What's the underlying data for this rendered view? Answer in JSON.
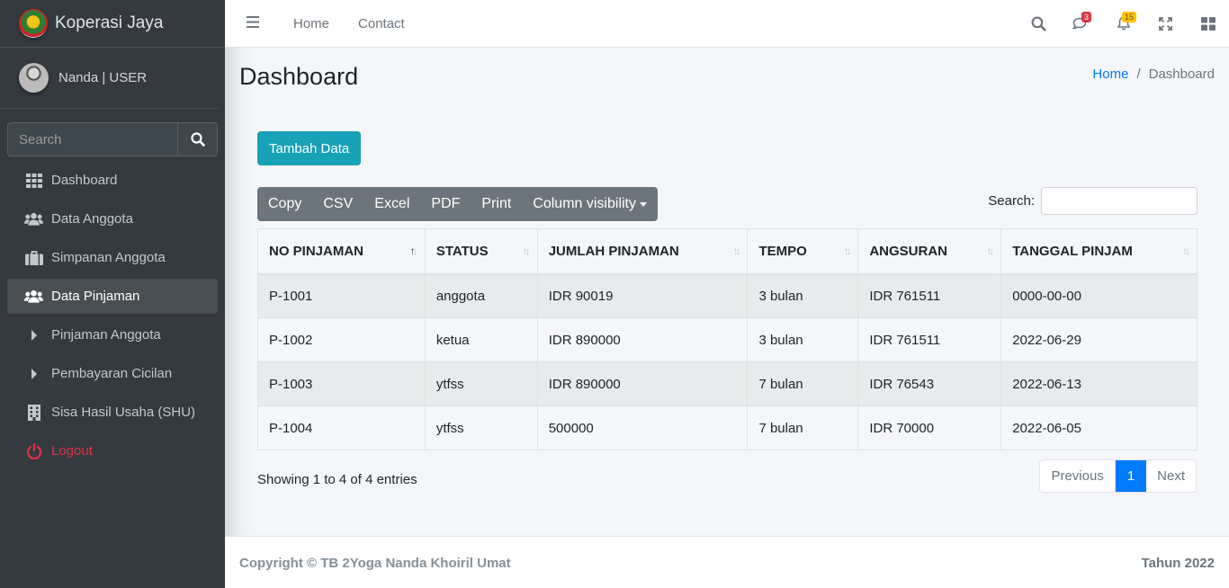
{
  "brand": {
    "name": "Koperasi Jaya"
  },
  "user": {
    "name": "Nanda | USER"
  },
  "sidebar_search": {
    "placeholder": "Search"
  },
  "sidebar": {
    "items": [
      {
        "label": "Dashboard",
        "icon": "grid-icon"
      },
      {
        "label": "Data Anggota",
        "icon": "users-icon"
      },
      {
        "label": "Simpanan Anggota",
        "icon": "briefcase-icon"
      },
      {
        "label": "Data Pinjaman",
        "icon": "users-icon",
        "active": true
      },
      {
        "label": "Pinjaman Anggota",
        "icon": "caret-right-icon"
      },
      {
        "label": "Pembayaran Cicilan",
        "icon": "caret-right-icon"
      },
      {
        "label": "Sisa Hasil Usaha (SHU)",
        "icon": "building-icon"
      },
      {
        "label": "Logout",
        "icon": "power-icon"
      }
    ]
  },
  "topbar": {
    "links": [
      "Home",
      "Contact"
    ],
    "messages_badge": "3",
    "notifications_badge": "15"
  },
  "header": {
    "title": "Dashboard",
    "breadcrumb": [
      "Home",
      "Dashboard"
    ]
  },
  "actions": {
    "add_label": "Tambah Data"
  },
  "export_buttons": [
    "Copy",
    "CSV",
    "Excel",
    "PDF",
    "Print",
    "Column visibility"
  ],
  "table_search": {
    "label": "Search:",
    "value": ""
  },
  "table": {
    "columns": [
      "NO PINJAMAN",
      "STATUS",
      "JUMLAH PINJAMAN",
      "TEMPO",
      "ANGSURAN",
      "TANGGAL PINJAM"
    ],
    "rows": [
      [
        "P-1001",
        "anggota",
        "IDR 90019",
        "3 bulan",
        "IDR 761511",
        "0000-00-00"
      ],
      [
        "P-1002",
        "ketua",
        "IDR 890000",
        "3 bulan",
        "IDR 761511",
        "2022-06-29"
      ],
      [
        "P-1003",
        "ytfss",
        "IDR 890000",
        "7 bulan",
        "IDR 76543",
        "2022-06-13"
      ],
      [
        "P-1004",
        "ytfss",
        "500000",
        "7 bulan",
        "IDR 70000",
        "2022-06-05"
      ]
    ]
  },
  "info": "Showing 1 to 4 of 4 entries",
  "pagination": {
    "previous": "Previous",
    "current": "1",
    "next": "Next"
  },
  "footer": {
    "copyright": "Copyright © TB 2Yoga Nanda Khoiril Umat",
    "year": "Tahun 2022"
  },
  "colors": {
    "sidebar": "#343a40",
    "accent": "#17a2b8",
    "primary": "#007bff",
    "danger": "#dc3545"
  }
}
